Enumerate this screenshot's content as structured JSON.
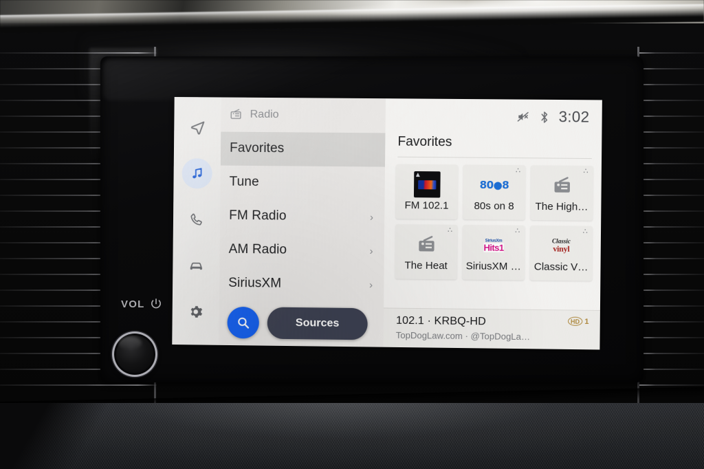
{
  "hardware": {
    "vol_label": "VOL",
    "power_icon": "power-icon",
    "knob": "volume-knob"
  },
  "screen": {
    "rail": {
      "items": [
        {
          "icon": "navigation-arrow-icon",
          "name": "navigation",
          "active": false
        },
        {
          "icon": "music-note-icon",
          "name": "media",
          "active": true
        },
        {
          "icon": "phone-icon",
          "name": "phone",
          "active": false
        },
        {
          "icon": "car-icon",
          "name": "vehicle",
          "active": false
        },
        {
          "icon": "gear-icon",
          "name": "settings",
          "active": false
        }
      ]
    },
    "panel": {
      "header_icon": "radio-icon",
      "header_title": "Radio",
      "items": [
        {
          "label": "Favorites",
          "selected": true,
          "chevron": ""
        },
        {
          "label": "Tune",
          "selected": false,
          "chevron": ""
        },
        {
          "label": "FM Radio",
          "selected": false,
          "chevron": "›"
        },
        {
          "label": "AM Radio",
          "selected": false,
          "chevron": "›"
        },
        {
          "label": "SiriusXM",
          "selected": false,
          "chevron": "›"
        }
      ],
      "search_icon": "search-icon",
      "sources_label": "Sources"
    },
    "status": {
      "mute_icon": "volume-mute-icon",
      "bluetooth_icon": "bluetooth-icon",
      "time": "3:02"
    },
    "favorites": {
      "title": "Favorites",
      "tiles": [
        {
          "label": "FM 102.1",
          "art": "station-album-art",
          "pin": ""
        },
        {
          "label": "80s on 8",
          "art": "80s-on-8-logo",
          "pin": "∴",
          "logo_text": "80●8"
        },
        {
          "label": "The High…",
          "art": "radio-icon",
          "pin": "∴"
        },
        {
          "label": "The Heat",
          "art": "radio-icon",
          "pin": "∴"
        },
        {
          "label": "SiriusXM …",
          "art": "siriusxm-hits1-logo",
          "pin": "∴",
          "logo_line1": "SiriusXm",
          "logo_line2": "Hits1"
        },
        {
          "label": "Classic V…",
          "art": "classic-vinyl-logo",
          "pin": "∴",
          "logo_line1": "Classic",
          "logo_line2": "vinyl"
        }
      ]
    },
    "now_playing": {
      "title": "102.1 · KRBQ-HD",
      "subtitle": "TopDogLaw.com · @TopDogLa…",
      "hd_badge_mark": "HD",
      "hd_badge_channel": "1",
      "hd_badge_color": "#b08a3e"
    }
  },
  "colors": {
    "accent_blue": "#1360f2",
    "sources_navy": "#3d4152",
    "rail_active_bg": "#dde6f5",
    "rail_active_fg": "#1e5fd8",
    "screen_bg": "#f2f1ef",
    "selected_row": "#d6d5d3"
  }
}
